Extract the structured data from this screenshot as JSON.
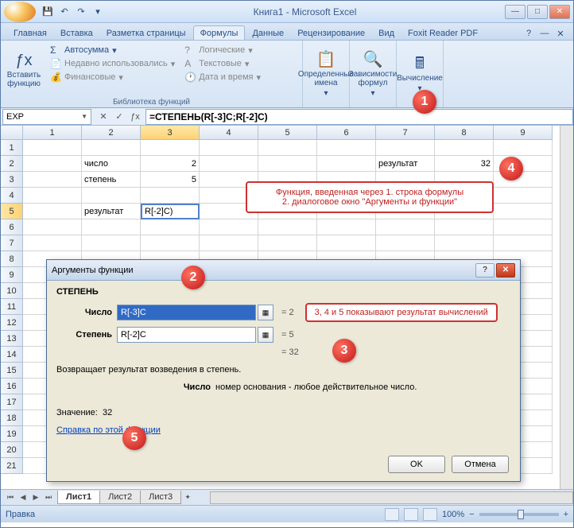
{
  "title": "Книга1 - Microsoft Excel",
  "tabs": {
    "t0": "Главная",
    "t1": "Вставка",
    "t2": "Разметка страницы",
    "t3": "Формулы",
    "t4": "Данные",
    "t5": "Рецензирование",
    "t6": "Вид",
    "t7": "Foxit Reader PDF"
  },
  "ribbon": {
    "insert_fn": "Вставить функцию",
    "autosum": "Автосумма",
    "recent": "Недавно использовались",
    "financial": "Финансовые",
    "logical": "Логические",
    "text": "Текстовые",
    "datetime": "Дата и время",
    "group1": "Библиотека функций",
    "names": "Определенные имена",
    "deps": "Зависимости формул",
    "calc": "Вычисление"
  },
  "formula_bar": {
    "name_box": "EXP",
    "formula": "=СТЕПЕНЬ(R[-3]C;R[-2]C)"
  },
  "cols": [
    "1",
    "2",
    "3",
    "4",
    "5",
    "6",
    "7",
    "8",
    "9"
  ],
  "rows": [
    "1",
    "2",
    "3",
    "4",
    "5",
    "6",
    "7",
    "8",
    "9",
    "10",
    "11",
    "12",
    "13",
    "14",
    "15",
    "16",
    "17",
    "18",
    "19",
    "20",
    "21"
  ],
  "cells": {
    "r2c2": "число",
    "r2c3": "2",
    "r2c7": "результат",
    "r2c8": "32",
    "r3c2": "степень",
    "r3c3": "5",
    "r5c2": "результат",
    "r5c3": "R[-2]C)"
  },
  "callout1": {
    "line1": "Функция, введенная через 1. строка формулы",
    "line2": "2. диалоговое окно \"Аргументы и функции\""
  },
  "callout2": "3, 4 и 5 показывают результат вычислений",
  "dialog": {
    "title": "Аргументы функции",
    "func": "СТЕПЕНЬ",
    "arg1_label": "Число",
    "arg1_val": "R[-3]C",
    "arg1_res": "=   2",
    "arg2_label": "Степень",
    "arg2_val": "R[-2]C",
    "arg2_res": "=   5",
    "result": "=   32",
    "desc": "Возвращает результат возведения в степень.",
    "argdesc_label": "Число",
    "argdesc": "номер основания - любое действительное число.",
    "value_label": "Значение:",
    "value": "32",
    "help": "Справка по этой функции",
    "ok": "OK",
    "cancel": "Отмена"
  },
  "sheets": {
    "s1": "Лист1",
    "s2": "Лист2",
    "s3": "Лист3"
  },
  "status": "Правка",
  "zoom": "100%",
  "badges": {
    "b1": "1",
    "b2": "2",
    "b3": "3",
    "b4": "4",
    "b5": "5"
  }
}
